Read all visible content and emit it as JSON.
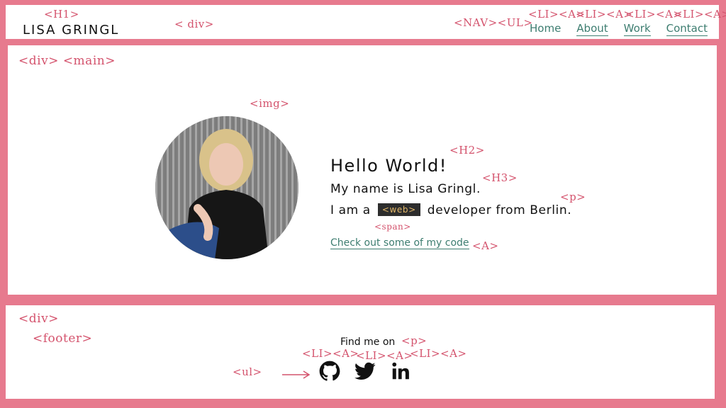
{
  "header": {
    "site_title": "LISA GRINGL",
    "nav": [
      {
        "label": "Home"
      },
      {
        "label": "About"
      },
      {
        "label": "Work"
      },
      {
        "label": "Contact"
      }
    ]
  },
  "main": {
    "hello": "Hello World!",
    "name_line": "My name is Lisa Gringl.",
    "about_before": "I am a",
    "about_badge": "<web>",
    "about_after": "developer from Berlin.",
    "code_link": "Check out some of my code"
  },
  "footer": {
    "find_me": "Find me on",
    "social": [
      {
        "name": "github-icon"
      },
      {
        "name": "twitter-icon"
      },
      {
        "name": "linkedin-icon"
      }
    ]
  },
  "annotations": {
    "h1": "<H1>",
    "div_header": "< div>",
    "nav_ul": "<NAV><UL>",
    "li_a": "<LI><A>",
    "div_main": "<div> <main>",
    "img": "<img>",
    "h2": "<H2>",
    "h3": "<H3>",
    "p_main": "<p>",
    "span": "<span>",
    "a_main": "<A>",
    "div_footer": "<div>",
    "footer": "<footer>",
    "p_footer": "<p>",
    "ul_footer": "<ul>"
  }
}
